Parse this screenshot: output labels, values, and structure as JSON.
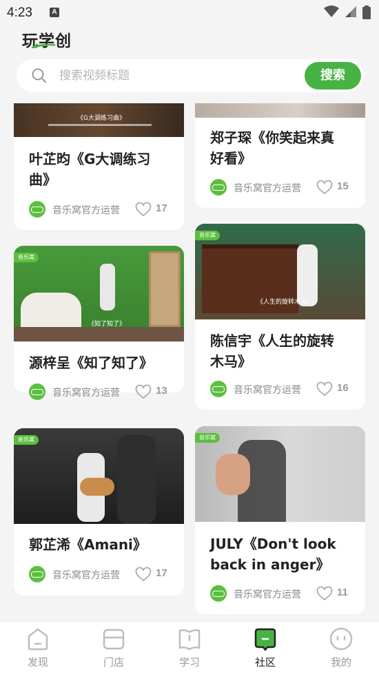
{
  "status_bar": {
    "time": "4:23",
    "indicator": "A"
  },
  "header": {
    "title": "玩学创"
  },
  "search": {
    "placeholder": "搜索视频标题",
    "button_label": "搜索"
  },
  "feed": {
    "cards": [
      {
        "title_line1": "叶芷昀《G大调练习",
        "title_line2": "曲》",
        "author": "音乐窝官方运营",
        "likes": "17",
        "video_caption": "《G大调练习曲》"
      },
      {
        "title_line1": "郑子琛《你笑起来真",
        "title_line2": "好看》",
        "author": "音乐窝官方运营",
        "likes": "15"
      },
      {
        "title_line1": "源梓呈《知了知了》",
        "title_line2": "",
        "author": "音乐窝官方运营",
        "likes": "13",
        "video_caption": "《知了知了》",
        "brand": "音乐窝"
      },
      {
        "title_line1": "陈信宇《人生的旋转",
        "title_line2": "木马》",
        "author": "音乐窝官方运营",
        "likes": "16",
        "video_caption": "《人生的旋转木马》",
        "brand": "音乐窝"
      },
      {
        "title_line1": "郭芷浠《Amani》",
        "title_line2": "",
        "author": "音乐窝官方运营",
        "likes": "17",
        "brand": "音乐窝"
      },
      {
        "title_line1": "JULY《Don't look",
        "title_line2": "back in anger》",
        "author": "音乐窝官方运营",
        "likes": "11",
        "brand": "音乐窝"
      }
    ]
  },
  "bottom_nav": {
    "items": [
      {
        "label": "发现",
        "icon": "home-icon"
      },
      {
        "label": "门店",
        "icon": "store-icon"
      },
      {
        "label": "学习",
        "icon": "book-icon"
      },
      {
        "label": "社区",
        "icon": "chat-icon",
        "active": true
      },
      {
        "label": "我的",
        "icon": "profile-icon"
      }
    ]
  },
  "colors": {
    "accent": "#47b344",
    "background": "#f4f4f4"
  }
}
